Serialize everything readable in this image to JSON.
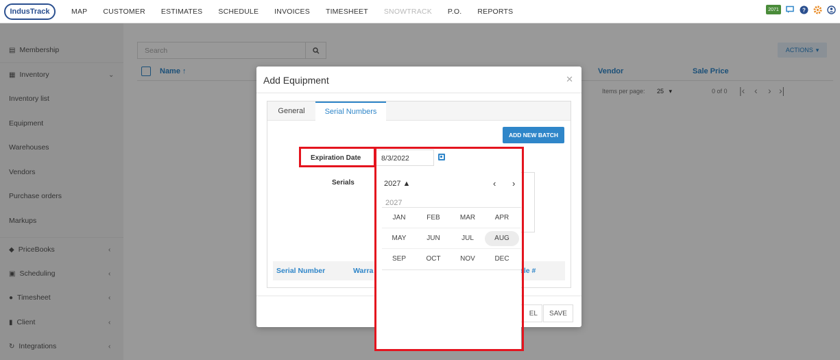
{
  "nav": {
    "logo": "IndusTrack",
    "items": [
      "MAP",
      "CUSTOMER",
      "ESTIMATES",
      "SCHEDULE",
      "INVOICES",
      "TIMESHEET",
      "SNOWTRACK",
      "P.O.",
      "REPORTS"
    ],
    "badge": "2071"
  },
  "sidebar": {
    "items": [
      "Membership",
      "Inventory",
      "Inventory list",
      "Equipment",
      "Warehouses",
      "Vendors",
      "Purchase orders",
      "Markups",
      "PriceBooks",
      "Scheduling",
      "Timesheet",
      "Client",
      "Integrations"
    ]
  },
  "main": {
    "search_placeholder": "Search",
    "actions_label": "ACTIONS",
    "columns": [
      "Name",
      "Vendor",
      "Sale Price"
    ],
    "pager": {
      "items_per_page_label": "Items per page:",
      "items_per_page": "25",
      "range": "0 of 0"
    }
  },
  "modal": {
    "title": "Add Equipment",
    "tabs": [
      "General",
      "Serial Numbers"
    ],
    "add_batch_label": "ADD NEW BATCH",
    "expiration_label": "Expiration Date",
    "expiration_value": "8/3/2022",
    "serials_label": "Serials",
    "grid_columns": [
      "Serial Number",
      "Warra",
      "sle #"
    ],
    "cancel_label": "EL",
    "save_label": "SAVE"
  },
  "picker": {
    "year_toggle": "2027 ▲",
    "year": "2027",
    "months": [
      [
        "JAN",
        "FEB",
        "MAR",
        "APR"
      ],
      [
        "MAY",
        "JUN",
        "JUL",
        "AUG"
      ],
      [
        "SEP",
        "OCT",
        "NOV",
        "DEC"
      ]
    ],
    "selected": "AUG"
  },
  "colors": {
    "accent": "#2f86c9",
    "highlight": "#e4141e",
    "logo": "#2a4f8f"
  }
}
